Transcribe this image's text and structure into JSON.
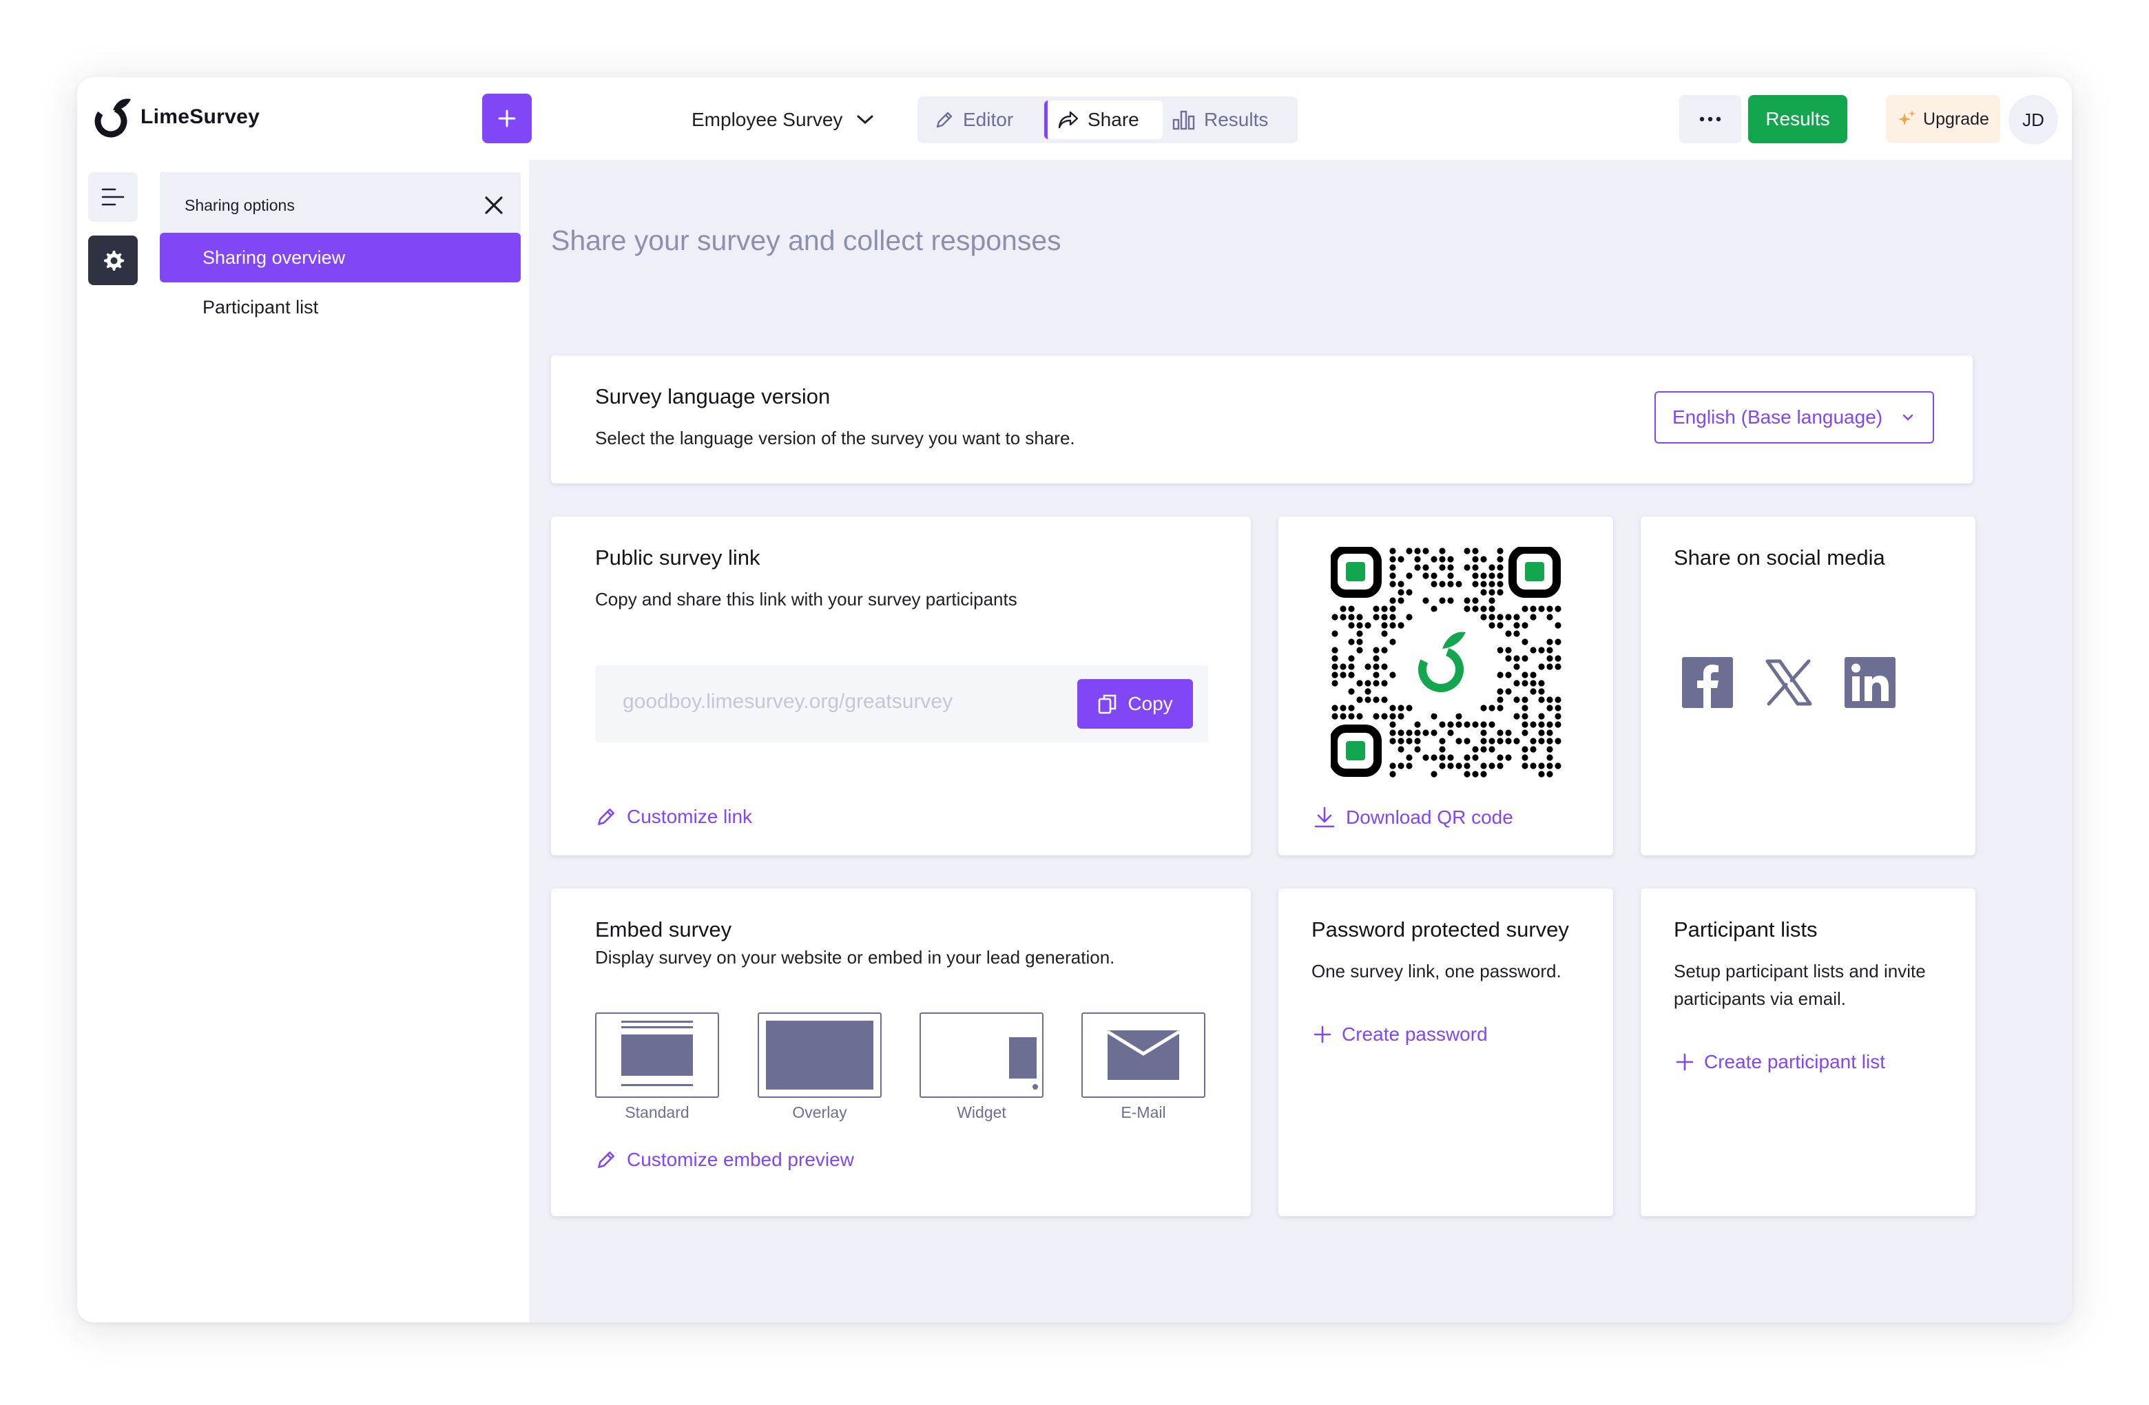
{
  "app": {
    "logo_text": "LimeSurvey",
    "survey_name": "Employee Survey",
    "accent_color": "#8146f6",
    "success_color": "#14a64f"
  },
  "topbar": {
    "add_icon": "plus-icon",
    "tabs": [
      {
        "label": "Editor",
        "icon": "pencil-icon"
      },
      {
        "label": "Share",
        "icon": "share-arrow-icon",
        "active": true
      },
      {
        "label": "Results",
        "icon": "bar-chart-icon"
      }
    ],
    "more_icon": "more-dots-icon",
    "results_button": "Results",
    "upgrade_button": "Upgrade",
    "avatar_initials": "JD"
  },
  "sidepanel": {
    "title": "Sharing options",
    "items": [
      {
        "label": "Sharing overview",
        "active": true
      },
      {
        "label": "Participant list"
      }
    ]
  },
  "main": {
    "page_title": "Share your survey and collect responses",
    "language_card": {
      "title": "Survey language version",
      "description": "Select the language version of the survey you want to share.",
      "selected_language": "English (Base language)"
    },
    "public_link_card": {
      "title": "Public survey link",
      "description": "Copy and share this link with your survey participants",
      "url": "goodboy.limesurvey.org/greatsurvey",
      "copy_button": "Copy",
      "customize_link": "Customize link"
    },
    "qr_card": {
      "download_link": "Download QR code"
    },
    "social_card": {
      "title": "Share on social media",
      "networks": [
        "facebook-icon",
        "x-icon",
        "linkedin-icon"
      ]
    },
    "embed_card": {
      "title": "Embed survey",
      "description": "Display survey on your website or embed in your lead generation.",
      "options": [
        "Standard",
        "Overlay",
        "Widget",
        "E-Mail"
      ],
      "customize_link": "Customize embed preview"
    },
    "password_card": {
      "title": "Password protected survey",
      "description": "One survey link, one password.",
      "action": "Create password"
    },
    "participants_card": {
      "title": "Participant lists",
      "description": "Setup participant lists and invite participants via email.",
      "action": "Create participant list"
    }
  }
}
